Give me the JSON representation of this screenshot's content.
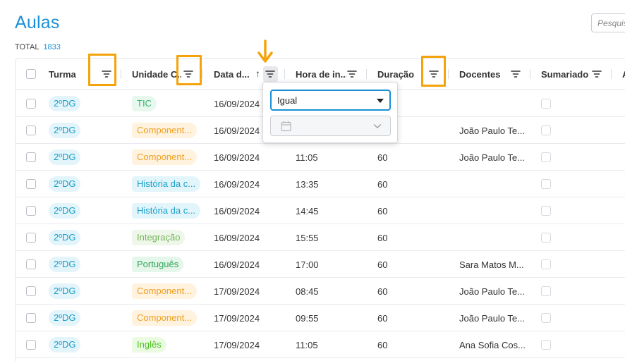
{
  "page": {
    "title": "Aulas",
    "total_label": "TOTAL",
    "total_count": "1833"
  },
  "search": {
    "placeholder": "Pesquisar"
  },
  "columns": [
    {
      "key": "turma",
      "label": "Turma"
    },
    {
      "key": "uc",
      "label": "Unidade C..."
    },
    {
      "key": "data",
      "label": "Data d..."
    },
    {
      "key": "hora",
      "label": "Hora de in..."
    },
    {
      "key": "duracao",
      "label": "Duração"
    },
    {
      "key": "docentes",
      "label": "Docentes"
    },
    {
      "key": "sumariado",
      "label": "Sumariado"
    },
    {
      "key": "next",
      "label": "A"
    }
  ],
  "sort": {
    "column": "data",
    "direction": "asc",
    "glyph": "↑"
  },
  "filter_popup": {
    "operator_value": "Igual",
    "date_icon": "calendar-icon",
    "date_chevron": "chevron-down-icon"
  },
  "colors": {
    "accent": "#1a8fd8",
    "highlight": "#f5a30a",
    "tag_turma_bg": "#e4f4fb",
    "tag_turma_fg": "#1aa0c8"
  },
  "rows": [
    {
      "turma": "2ºDG",
      "uc": "TIC",
      "uc_bg": "#e8f8ee",
      "uc_fg": "#2fb86a",
      "data": "16/09/2024",
      "hora": "",
      "duracao": "",
      "docentes": ""
    },
    {
      "turma": "2ºDG",
      "uc": "Component...",
      "uc_bg": "#fff2de",
      "uc_fg": "#f0a024",
      "data": "16/09/2024",
      "hora": "",
      "duracao": "",
      "docentes": "João Paulo Te..."
    },
    {
      "turma": "2ºDG",
      "uc": "Component...",
      "uc_bg": "#fff2de",
      "uc_fg": "#f0a024",
      "data": "16/09/2024",
      "hora": "11:05",
      "duracao": "60",
      "docentes": "João Paulo Te..."
    },
    {
      "turma": "2ºDG",
      "uc": "História da c...",
      "uc_bg": "#e2f5fb",
      "uc_fg": "#1aa0c8",
      "data": "16/09/2024",
      "hora": "13:35",
      "duracao": "60",
      "docentes": ""
    },
    {
      "turma": "2ºDG",
      "uc": "História da c...",
      "uc_bg": "#e2f5fb",
      "uc_fg": "#1aa0c8",
      "data": "16/09/2024",
      "hora": "14:45",
      "duracao": "60",
      "docentes": ""
    },
    {
      "turma": "2ºDG",
      "uc": "Integração",
      "uc_bg": "#eef7ea",
      "uc_fg": "#76b65a",
      "data": "16/09/2024",
      "hora": "15:55",
      "duracao": "60",
      "docentes": ""
    },
    {
      "turma": "2ºDG",
      "uc": "Português",
      "uc_bg": "#e5f6ea",
      "uc_fg": "#2fa65a",
      "data": "16/09/2024",
      "hora": "17:00",
      "duracao": "60",
      "docentes": "Sara Matos M..."
    },
    {
      "turma": "2ºDG",
      "uc": "Component...",
      "uc_bg": "#fff2de",
      "uc_fg": "#f0a024",
      "data": "17/09/2024",
      "hora": "08:45",
      "duracao": "60",
      "docentes": "João Paulo Te..."
    },
    {
      "turma": "2ºDG",
      "uc": "Component...",
      "uc_bg": "#fff2de",
      "uc_fg": "#f0a024",
      "data": "17/09/2024",
      "hora": "09:55",
      "duracao": "60",
      "docentes": "João Paulo Te..."
    },
    {
      "turma": "2ºDG",
      "uc": "Inglês",
      "uc_bg": "#eafbe2",
      "uc_fg": "#4cc21f",
      "data": "17/09/2024",
      "hora": "11:05",
      "duracao": "60",
      "docentes": "Ana Sofia Cos..."
    }
  ]
}
